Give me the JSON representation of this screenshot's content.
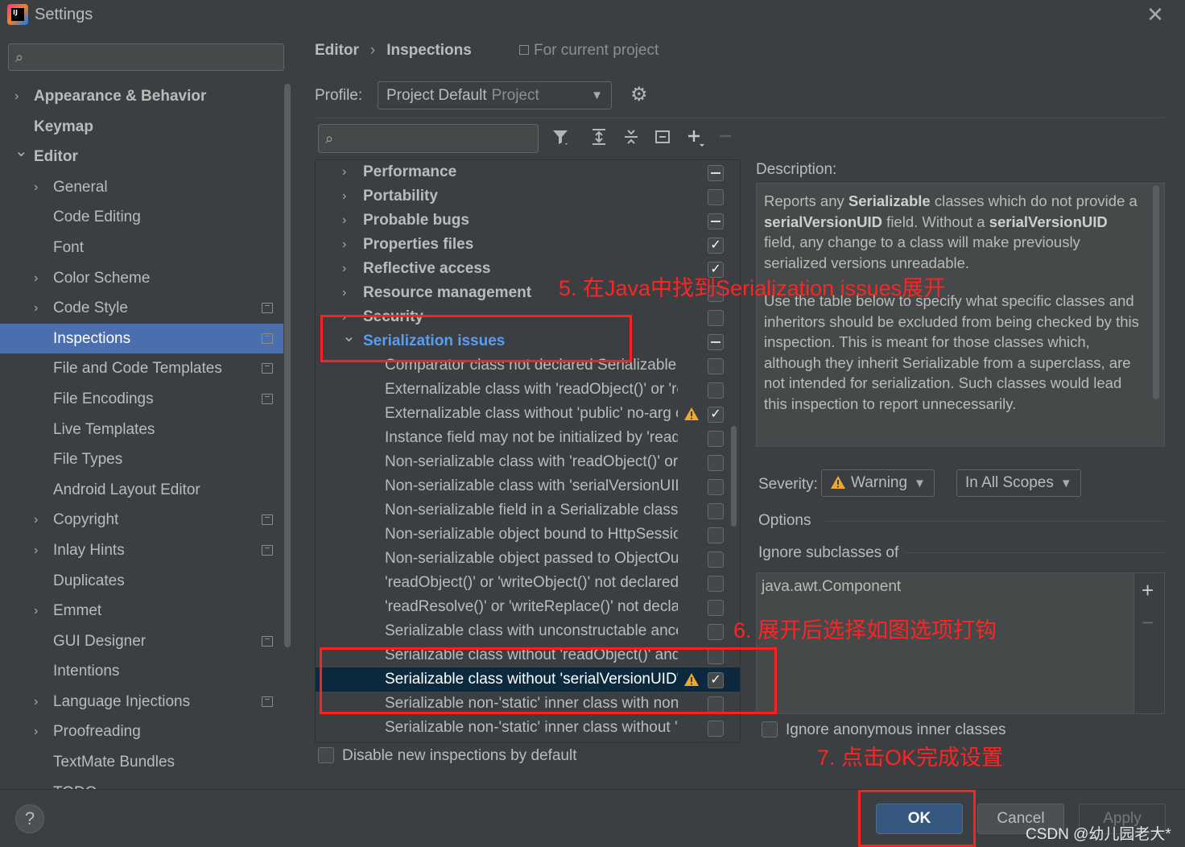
{
  "window": {
    "title": "Settings",
    "logo_text": "IJ"
  },
  "sidebar": {
    "items": [
      {
        "label": "Appearance & Behavior",
        "indent": 0,
        "bold": true,
        "arrow": "right",
        "project": false,
        "selected": false
      },
      {
        "label": "Keymap",
        "indent": 0,
        "bold": true,
        "arrow": "",
        "project": false,
        "selected": false
      },
      {
        "label": "Editor",
        "indent": 0,
        "bold": true,
        "arrow": "down",
        "project": false,
        "selected": false
      },
      {
        "label": "General",
        "indent": 1,
        "bold": false,
        "arrow": "right",
        "project": false,
        "selected": false
      },
      {
        "label": "Code Editing",
        "indent": 1,
        "bold": false,
        "arrow": "",
        "project": false,
        "selected": false
      },
      {
        "label": "Font",
        "indent": 1,
        "bold": false,
        "arrow": "",
        "project": false,
        "selected": false
      },
      {
        "label": "Color Scheme",
        "indent": 1,
        "bold": false,
        "arrow": "right",
        "project": false,
        "selected": false
      },
      {
        "label": "Code Style",
        "indent": 1,
        "bold": false,
        "arrow": "right",
        "project": true,
        "selected": false
      },
      {
        "label": "Inspections",
        "indent": 1,
        "bold": false,
        "arrow": "",
        "project": true,
        "selected": true
      },
      {
        "label": "File and Code Templates",
        "indent": 1,
        "bold": false,
        "arrow": "",
        "project": true,
        "selected": false
      },
      {
        "label": "File Encodings",
        "indent": 1,
        "bold": false,
        "arrow": "",
        "project": true,
        "selected": false
      },
      {
        "label": "Live Templates",
        "indent": 1,
        "bold": false,
        "arrow": "",
        "project": false,
        "selected": false
      },
      {
        "label": "File Types",
        "indent": 1,
        "bold": false,
        "arrow": "",
        "project": false,
        "selected": false
      },
      {
        "label": "Android Layout Editor",
        "indent": 1,
        "bold": false,
        "arrow": "",
        "project": false,
        "selected": false
      },
      {
        "label": "Copyright",
        "indent": 1,
        "bold": false,
        "arrow": "right",
        "project": true,
        "selected": false
      },
      {
        "label": "Inlay Hints",
        "indent": 1,
        "bold": false,
        "arrow": "right",
        "project": true,
        "selected": false
      },
      {
        "label": "Duplicates",
        "indent": 1,
        "bold": false,
        "arrow": "",
        "project": false,
        "selected": false
      },
      {
        "label": "Emmet",
        "indent": 1,
        "bold": false,
        "arrow": "right",
        "project": false,
        "selected": false
      },
      {
        "label": "GUI Designer",
        "indent": 1,
        "bold": false,
        "arrow": "",
        "project": true,
        "selected": false
      },
      {
        "label": "Intentions",
        "indent": 1,
        "bold": false,
        "arrow": "",
        "project": false,
        "selected": false
      },
      {
        "label": "Language Injections",
        "indent": 1,
        "bold": false,
        "arrow": "right",
        "project": true,
        "selected": false
      },
      {
        "label": "Proofreading",
        "indent": 1,
        "bold": false,
        "arrow": "right",
        "project": false,
        "selected": false
      },
      {
        "label": "TextMate Bundles",
        "indent": 1,
        "bold": false,
        "arrow": "",
        "project": false,
        "selected": false
      },
      {
        "label": "TODO",
        "indent": 1,
        "bold": false,
        "arrow": "",
        "project": false,
        "selected": false
      }
    ]
  },
  "header": {
    "breadcrumb": [
      "Editor",
      "Inspections"
    ],
    "scope_note": "For current project",
    "profile_label": "Profile:",
    "profile_value": "Project Default",
    "profile_type": "Project"
  },
  "toolbar": {
    "icons": [
      "filter-icon",
      "expand-all-icon",
      "collapse-all-icon",
      "reset-icon",
      "add-icon",
      "remove-icon"
    ]
  },
  "inspections": [
    {
      "label": "Performance",
      "group": true,
      "expanded": false,
      "state": "partial",
      "warn": false,
      "selected": false
    },
    {
      "label": "Portability",
      "group": true,
      "expanded": false,
      "state": "unchecked",
      "warn": false,
      "selected": false
    },
    {
      "label": "Probable bugs",
      "group": true,
      "expanded": false,
      "state": "partial",
      "warn": false,
      "selected": false
    },
    {
      "label": "Properties files",
      "group": true,
      "expanded": false,
      "state": "checked",
      "warn": false,
      "selected": false
    },
    {
      "label": "Reflective access",
      "group": true,
      "expanded": false,
      "state": "checked",
      "warn": false,
      "selected": false
    },
    {
      "label": "Resource management",
      "group": true,
      "expanded": false,
      "state": "unchecked",
      "warn": false,
      "selected": false
    },
    {
      "label": "Security",
      "group": true,
      "expanded": false,
      "state": "unchecked",
      "warn": false,
      "selected": false
    },
    {
      "label": "Serialization issues",
      "group": true,
      "expanded": true,
      "state": "partial",
      "warn": false,
      "selected": false
    },
    {
      "label": "Comparator class not declared Serializable",
      "group": false,
      "state": "unchecked",
      "warn": false,
      "selected": false
    },
    {
      "label": "Externalizable class with 'readObject()' or 'readResolve()'",
      "group": false,
      "state": "unchecked",
      "warn": false,
      "selected": false
    },
    {
      "label": "Externalizable class without 'public' no-arg constructor",
      "group": false,
      "state": "checked",
      "warn": true,
      "selected": false
    },
    {
      "label": "Instance field may not be initialized by 'readObject()'",
      "group": false,
      "state": "unchecked",
      "warn": false,
      "selected": false
    },
    {
      "label": "Non-serializable class with 'readObject()' or 'writeObject()'",
      "group": false,
      "state": "unchecked",
      "warn": false,
      "selected": false
    },
    {
      "label": "Non-serializable class with 'serialVersionUID'",
      "group": false,
      "state": "unchecked",
      "warn": false,
      "selected": false
    },
    {
      "label": "Non-serializable field in a Serializable class",
      "group": false,
      "state": "unchecked",
      "warn": false,
      "selected": false
    },
    {
      "label": "Non-serializable object bound to HttpSession",
      "group": false,
      "state": "unchecked",
      "warn": false,
      "selected": false
    },
    {
      "label": "Non-serializable object passed to ObjectOutputStream",
      "group": false,
      "state": "unchecked",
      "warn": false,
      "selected": false
    },
    {
      "label": "'readObject()' or 'writeObject()' not declared 'private'",
      "group": false,
      "state": "unchecked",
      "warn": false,
      "selected": false
    },
    {
      "label": "'readResolve()' or 'writeReplace()' not declared 'protected'",
      "group": false,
      "state": "unchecked",
      "warn": false,
      "selected": false
    },
    {
      "label": "Serializable class with unconstructable ancestor",
      "group": false,
      "state": "unchecked",
      "warn": false,
      "selected": false
    },
    {
      "label": "Serializable class without 'readObject()' and 'writeObject()'",
      "group": false,
      "state": "unchecked",
      "warn": false,
      "selected": false
    },
    {
      "label": "Serializable class without 'serialVersionUID'",
      "group": false,
      "state": "checked",
      "warn": true,
      "selected": true
    },
    {
      "label": "Serializable non-'static' inner class with non-Serializable outer class",
      "group": false,
      "state": "unchecked",
      "warn": false,
      "selected": false
    },
    {
      "label": "Serializable non-'static' inner class without 'serialVersionUID'",
      "group": false,
      "state": "unchecked",
      "warn": false,
      "selected": false
    }
  ],
  "disable_new_label": "Disable new inspections by default",
  "description": {
    "label": "Description:",
    "p1": [
      {
        "t": "Reports any ",
        "b": false
      },
      {
        "t": "Serializable",
        "b": true
      },
      {
        "t": " classes which do not provide a ",
        "b": false
      },
      {
        "t": "serialVersionUID",
        "b": true
      },
      {
        "t": " field. Without a ",
        "b": false
      },
      {
        "t": "serialVersionUID",
        "b": true
      },
      {
        "t": " field, any change to a class will make previously serialized versions unreadable.",
        "b": false
      }
    ],
    "p2": "Use the table below to specify what specific classes and inheritors should be excluded from being checked by this inspection. This is meant for those classes which, although they inherit Serializable from a superclass, are not intended for serialization. Such classes would lead this inspection to report unnecessarily."
  },
  "severity": {
    "label": "Severity:",
    "value": "Warning",
    "scope": "In All Scopes"
  },
  "options": {
    "label": "Options",
    "ignore_label": "Ignore subclasses of",
    "ignore_items": [
      "java.awt.Component"
    ],
    "add_symbol": "+",
    "remove_symbol": "−",
    "ignore_anonymous_label": "Ignore anonymous inner classes"
  },
  "buttons": {
    "ok": "OK",
    "cancel": "Cancel",
    "apply": "Apply",
    "help": "?"
  },
  "annotations": {
    "step5": "5. 在Java中找到Serialization issues展开",
    "step6": "6. 展开后选择如图选项打钩",
    "step7": "7. 点击OK完成设置",
    "color": "#ff2424"
  },
  "watermark": "CSDN @幼儿园老大*",
  "colors": {
    "selection": "#4b6eaf",
    "row_selected": "#0d293e",
    "ok_button": "#365880",
    "link": "#589df6",
    "warning": "#f0a732"
  }
}
